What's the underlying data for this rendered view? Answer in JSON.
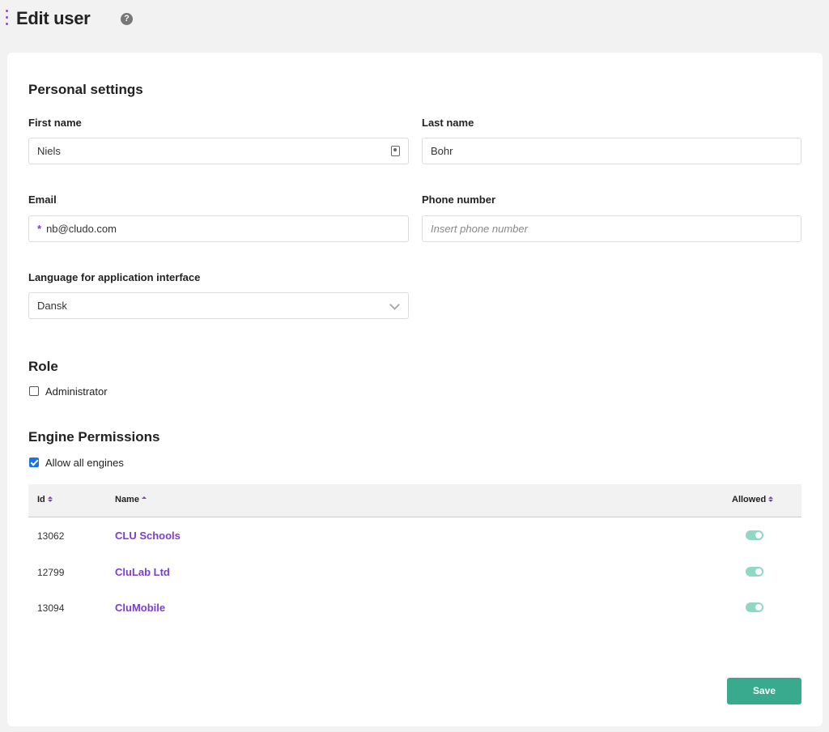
{
  "header": {
    "title": "Edit user"
  },
  "personal": {
    "title": "Personal settings",
    "first_name_label": "First name",
    "first_name_value": "Niels",
    "last_name_label": "Last name",
    "last_name_value": "Bohr",
    "email_label": "Email",
    "email_value": "nb@cludo.com",
    "email_required_mark": "*",
    "phone_label": "Phone number",
    "phone_placeholder": "Insert phone number",
    "language_label": "Language for application interface",
    "language_value": "Dansk"
  },
  "role": {
    "title": "Role",
    "administrator_label": "Administrator",
    "administrator_checked": false
  },
  "engines": {
    "title": "Engine Permissions",
    "allow_all_label": "Allow all engines",
    "allow_all_checked": true,
    "columns": {
      "id": "Id",
      "name": "Name",
      "allowed": "Allowed"
    },
    "rows": [
      {
        "id": "13062",
        "name": "CLU Schools",
        "allowed": true
      },
      {
        "id": "12799",
        "name": "CluLab Ltd",
        "allowed": true
      },
      {
        "id": "13094",
        "name": "CluMobile",
        "allowed": true
      }
    ]
  },
  "actions": {
    "save_label": "Save"
  },
  "colors": {
    "accent": "#7b3fd0",
    "save": "#3aaa8e",
    "toggle_on": "#8ed8c4"
  }
}
